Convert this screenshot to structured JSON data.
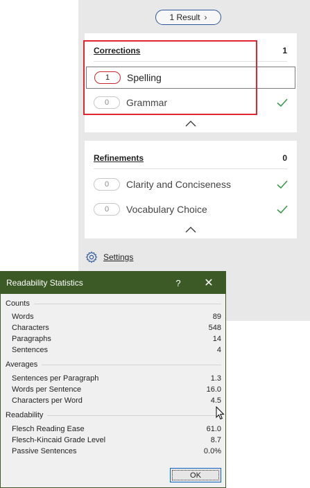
{
  "editor": {
    "results_label": "1 Result",
    "corrections": {
      "title": "Corrections",
      "count": "1",
      "items": [
        {
          "count": "1",
          "label": "Spelling",
          "done": false
        },
        {
          "count": "0",
          "label": "Grammar",
          "done": true
        }
      ]
    },
    "refinements": {
      "title": "Refinements",
      "count": "0",
      "items": [
        {
          "count": "0",
          "label": "Clarity and Conciseness",
          "done": true
        },
        {
          "count": "0",
          "label": "Vocabulary Choice",
          "done": true
        }
      ]
    },
    "settings_label": "Settings"
  },
  "dialog": {
    "title": "Readability Statistics",
    "help_label": "?",
    "close_label": "✕",
    "counts": {
      "heading": "Counts",
      "rows": [
        {
          "label": "Words",
          "value": "89"
        },
        {
          "label": "Characters",
          "value": "548"
        },
        {
          "label": "Paragraphs",
          "value": "14"
        },
        {
          "label": "Sentences",
          "value": "4"
        }
      ]
    },
    "averages": {
      "heading": "Averages",
      "rows": [
        {
          "label": "Sentences per Paragraph",
          "value": "1.3"
        },
        {
          "label": "Words per Sentence",
          "value": "16.0"
        },
        {
          "label": "Characters per Word",
          "value": "4.5"
        }
      ]
    },
    "readability": {
      "heading": "Readability",
      "rows": [
        {
          "label": "Flesch Reading Ease",
          "value": "61.0"
        },
        {
          "label": "Flesch-Kincaid Grade Level",
          "value": "8.7"
        },
        {
          "label": "Passive Sentences",
          "value": "0.0%"
        }
      ]
    },
    "ok_label": "OK"
  },
  "colors": {
    "dialog_title_bg": "#3b5a26",
    "accent_red": "#e0272f",
    "check_green": "#3a9a4a",
    "link_blue": "#2b579a"
  },
  "icons": [
    "chevron-right-icon",
    "checkmark-icon",
    "chevron-up-icon",
    "gear-icon",
    "help-icon",
    "close-icon",
    "mouse-cursor-icon"
  ]
}
